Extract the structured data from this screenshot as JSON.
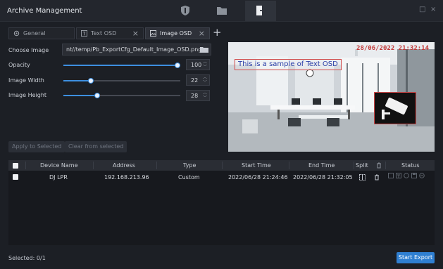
{
  "window": {
    "title": "Archive Management",
    "icons": [
      "shield-icon",
      "folder-icon",
      "export-door-icon"
    ]
  },
  "osd_tabs": [
    {
      "label": "General",
      "icon": "gear-icon",
      "closable": false,
      "active": false
    },
    {
      "label": "Text OSD",
      "icon": "text-box-icon",
      "closable": true,
      "active": false
    },
    {
      "label": "Image OSD",
      "icon": "image-icon",
      "closable": true,
      "active": true
    }
  ],
  "form": {
    "choose_image_label": "Choose Image",
    "image_path": "nt//temp/Pb_ExportCfg_Default_Image_OSD.png",
    "opacity_label": "Opacity",
    "opacity_value": "100",
    "opacity_fraction": 1.0,
    "width_label": "Image Width",
    "width_value": "22",
    "width_fraction": 0.22,
    "height_label": "Image Height",
    "height_value": "28",
    "height_fraction": 0.28
  },
  "preview": {
    "timestamp": "28/06/2022 21:32:14",
    "text_osd": "This is a sample of Text OSD"
  },
  "actions": {
    "apply_label": "Apply to Selected",
    "clear_label": "Clear from selected"
  },
  "table": {
    "columns": [
      "Device Name",
      "Address",
      "Type",
      "Start Time",
      "End Time",
      "Split",
      "Status"
    ],
    "rows": [
      {
        "device": "DJ LPR",
        "address": "192.168.213.96",
        "type": "Custom",
        "start": "2022/06/28 21:24:46",
        "end": "2022/06/28 21:32:05"
      }
    ]
  },
  "footer": {
    "selected": "Selected: 0/1",
    "start_label": "Start Export"
  },
  "colors": {
    "accent": "#3d8fe0",
    "osd_red": "#c33a3a",
    "osd_blue": "#2a3fa8"
  }
}
